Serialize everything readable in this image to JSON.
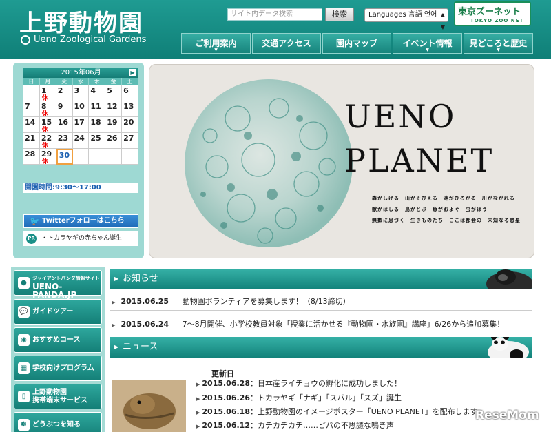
{
  "header": {
    "logo_jp": "上野動物園",
    "logo_en": "Ueno Zoological Gardens",
    "search_placeholder": "サイト内データ検索",
    "search_button": "検索",
    "language": "Languages 言語 언어",
    "zoonet_title": "東京ズーネット",
    "zoonet_sub": "TOKYO ZOO NET",
    "nav": [
      {
        "label": "ご利用案内",
        "dropdown": true
      },
      {
        "label": "交通アクセス",
        "dropdown": false
      },
      {
        "label": "園内マップ",
        "dropdown": false
      },
      {
        "label": "イベント情報",
        "dropdown": true
      },
      {
        "label": "見どころと歴史",
        "dropdown": true
      }
    ]
  },
  "calendar": {
    "month": "2015年06月",
    "next_icon": "chevron-right-icon",
    "weekdays": [
      "日",
      "月",
      "火",
      "水",
      "木",
      "金",
      "土"
    ],
    "days": [
      "",
      "1",
      "2",
      "3",
      "4",
      "5",
      "6",
      "7",
      "8",
      "9",
      "10",
      "11",
      "12",
      "13",
      "14",
      "15",
      "16",
      "17",
      "18",
      "19",
      "20",
      "21",
      "22",
      "23",
      "24",
      "25",
      "26",
      "27",
      "28",
      "29",
      "30",
      "",
      "",
      "",
      ""
    ],
    "closed_label": "休",
    "closed_days": [
      "1",
      "8",
      "15",
      "22",
      "29"
    ],
    "today": "30",
    "hours": "開園時間:9:30〜17:00"
  },
  "sidebar": {
    "twitter": "Twitterフォローはこちら",
    "pr_badge": "PR",
    "pr_text": "・トカラヤギの赤ちゃん誕生"
  },
  "hero": {
    "title_line1": "UENO",
    "title_line2": "PLANET",
    "lines": [
      "森がしげる　山がそびえる　池がひろがる　川がながれる",
      "獣がはしる　鳥がとぶ　魚がおよぐ　虫がはう",
      "無数に息づく　生きものたち　ここは都会の　未知なる惑星"
    ]
  },
  "left_menu": {
    "panda_small": "ジャイアントパンダ情報サイト",
    "panda_big": "UENO-PANDA.JP",
    "items": [
      {
        "label": "ガイドツアー",
        "icon": "speech-bubble-icon"
      },
      {
        "label": "おすすめコース",
        "icon": "map-pin-icon"
      },
      {
        "label": "学校向けプログラム",
        "icon": "school-icon"
      },
      {
        "label_line1": "上野動物園",
        "label_line2": "携帯端末サービス",
        "icon": "mobile-phone-icon"
      },
      {
        "label": "どうぶつを知る",
        "icon": "paw-icon"
      }
    ]
  },
  "notices": {
    "title": "お知らせ",
    "items": [
      {
        "date": "2015.06.25",
        "text": "動物園ボランティアを募集します！（8/13締切）"
      },
      {
        "date": "2015.06.24",
        "text": "7〜8月開催、小学校教員対象「授業に活かせる『動物園・水族園』講座」6/26から追加募集！"
      }
    ]
  },
  "news": {
    "title": "ニュース",
    "updated_label": "更新日",
    "items": [
      {
        "date": "2015.06.28",
        "text": "：日本産ライチョウの孵化に成功しました！"
      },
      {
        "date": "2015.06.26",
        "text": "：トカラヤギ「ナギ」「スバル」「スズ」誕生"
      },
      {
        "date": "2015.06.18",
        "text": "：上野動物園のイメージポスター「UENO PLANET」を配布します"
      },
      {
        "date": "2015.06.12",
        "text": "：カチカチカチ……ピパの不思議な鳴き声"
      }
    ]
  },
  "watermark": "ReseMom"
}
